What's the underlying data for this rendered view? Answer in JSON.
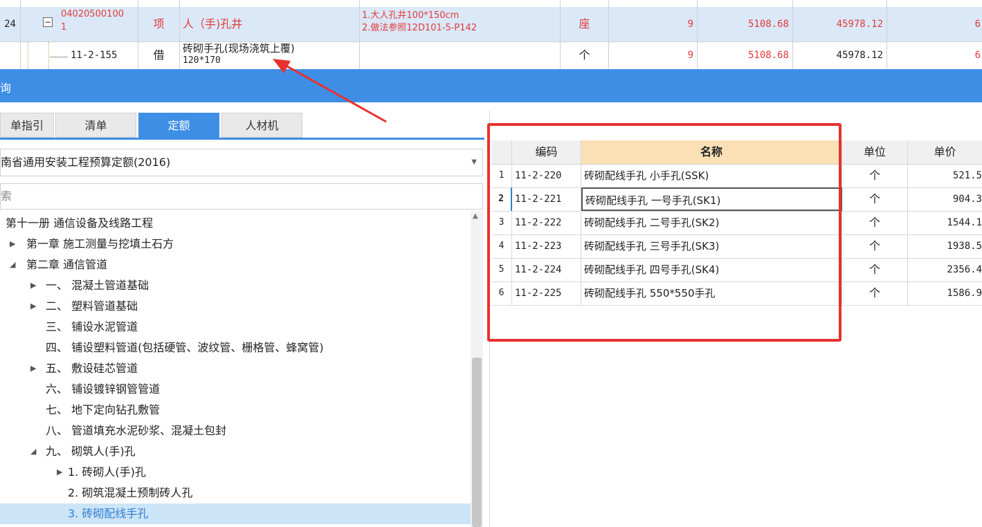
{
  "top_table": {
    "rows": [
      {
        "index": "24",
        "code": "04020500100",
        "code2": "1",
        "type": "项",
        "name": "人（手)孔井",
        "desc1": "1.大人孔井100*150cm",
        "desc2": "2.做法参照12D101-5-P142",
        "unit": "座",
        "qty": "9",
        "price": "5108.68",
        "total": "45978.12",
        "extra": "6"
      },
      {
        "index": "",
        "code": "11-2-155",
        "type": "借",
        "name": "砖砌手孔(现场浇筑上覆)",
        "name2": "120*170",
        "unit": "个",
        "qty": "9",
        "price": "5108.68",
        "total": "45978.12",
        "extra": "6"
      }
    ]
  },
  "bar_title": "询",
  "tabs": [
    {
      "label": "单指引"
    },
    {
      "label": "清单"
    },
    {
      "label": "定额"
    },
    {
      "label": "人材机"
    }
  ],
  "library_select": "南省通用安装工程预算定额(2016)",
  "search_placeholder": "索",
  "tree": [
    {
      "label": "第十一册 通信设备及线路工程",
      "arrow": ""
    },
    {
      "label": "第一章 施工测量与挖填土石方",
      "arrow": "▶"
    },
    {
      "label": "第二章 通信管道",
      "arrow": "◢"
    },
    {
      "label": "一、 混凝土管道基础",
      "arrow": "▶"
    },
    {
      "label": "二、 塑料管道基础",
      "arrow": "▶"
    },
    {
      "label": "三、 铺设水泥管道",
      "arrow": ""
    },
    {
      "label": "四、 铺设塑料管道(包括硬管、波纹管、栅格管、蜂窝管)",
      "arrow": ""
    },
    {
      "label": "五、 敷设硅芯管道",
      "arrow": "▶"
    },
    {
      "label": "六、 铺设镀锌钢管管道",
      "arrow": ""
    },
    {
      "label": "七、 地下定向钻孔敷管",
      "arrow": ""
    },
    {
      "label": "八、 管道填充水泥砂浆、混凝土包封",
      "arrow": ""
    },
    {
      "label": "九、 砌筑人(手)孔",
      "arrow": "◢"
    },
    {
      "label": "1. 砖砌人(手)孔",
      "arrow": "▶"
    },
    {
      "label": "2. 砌筑混凝土预制砖人孔",
      "arrow": ""
    },
    {
      "label": "3. 砖砌配线手孔",
      "arrow": ""
    }
  ],
  "quota_table": {
    "headers": {
      "code": "编码",
      "name": "名称",
      "unit": "单位",
      "price": "单价"
    },
    "rows": [
      {
        "no": "1",
        "code": "11-2-220",
        "name": "砖砌配线手孔 小手孔(SSK)",
        "unit": "个",
        "price": "521.5"
      },
      {
        "no": "2",
        "code": "11-2-221",
        "name": "砖砌配线手孔 一号手孔(SK1)",
        "unit": "个",
        "price": "904.3"
      },
      {
        "no": "3",
        "code": "11-2-222",
        "name": "砖砌配线手孔 二号手孔(SK2)",
        "unit": "个",
        "price": "1544.1"
      },
      {
        "no": "4",
        "code": "11-2-223",
        "name": "砖砌配线手孔 三号手孔(SK3)",
        "unit": "个",
        "price": "1938.5"
      },
      {
        "no": "5",
        "code": "11-2-224",
        "name": "砖砌配线手孔 四号手孔(SK4)",
        "unit": "个",
        "price": "2356.4"
      },
      {
        "no": "6",
        "code": "11-2-225",
        "name": "砖砌配线手孔 550*550手孔",
        "unit": "个",
        "price": "1586.9"
      }
    ]
  },
  "colors": {
    "accent": "#3e8ee6",
    "annotation": "#e8312f",
    "selected_row": "#dbe8f8"
  }
}
